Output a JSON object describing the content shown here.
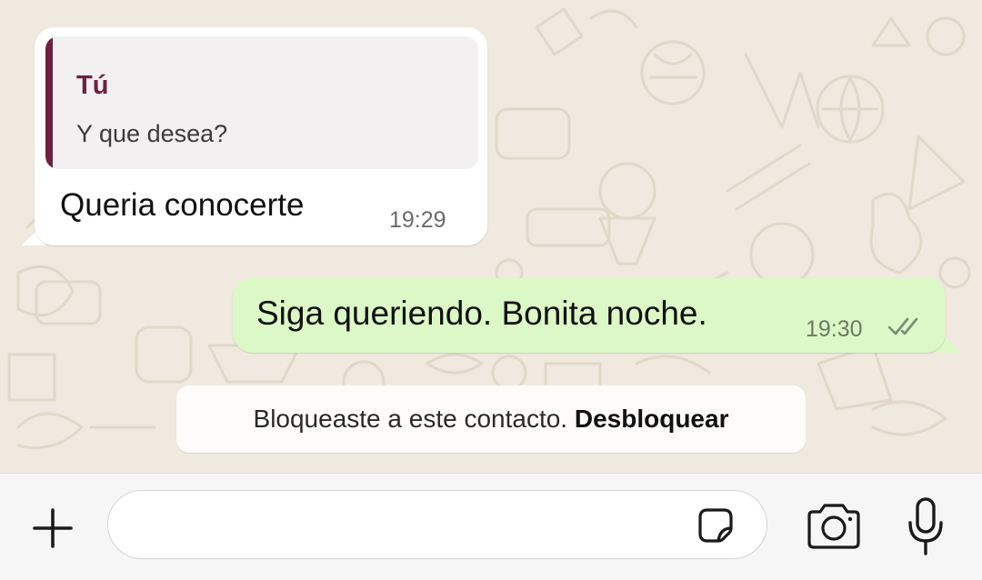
{
  "messages": {
    "incoming": {
      "quote_author": "Tú",
      "quote_text": "Y que desea?",
      "text": "Queria conocerte",
      "time": "19:29"
    },
    "outgoing": {
      "text": "Siga queriendo. Bonita noche.",
      "time": "19:30",
      "status_icon": "double-check-icon"
    }
  },
  "system_notice": {
    "text": "Bloqueaste a este contacto.",
    "action_label": "Desbloquear"
  },
  "composer": {
    "input_value": "",
    "input_placeholder": "",
    "icons": [
      "plus-icon",
      "sticker-icon",
      "camera-icon",
      "microphone-icon"
    ]
  },
  "colors": {
    "wallpaper": "#efe9df",
    "incoming_bubble": "#ffffff",
    "outgoing_bubble": "#dcf8c6",
    "quote_accent": "#6d2140",
    "composer_bar": "#f6f6f6"
  }
}
